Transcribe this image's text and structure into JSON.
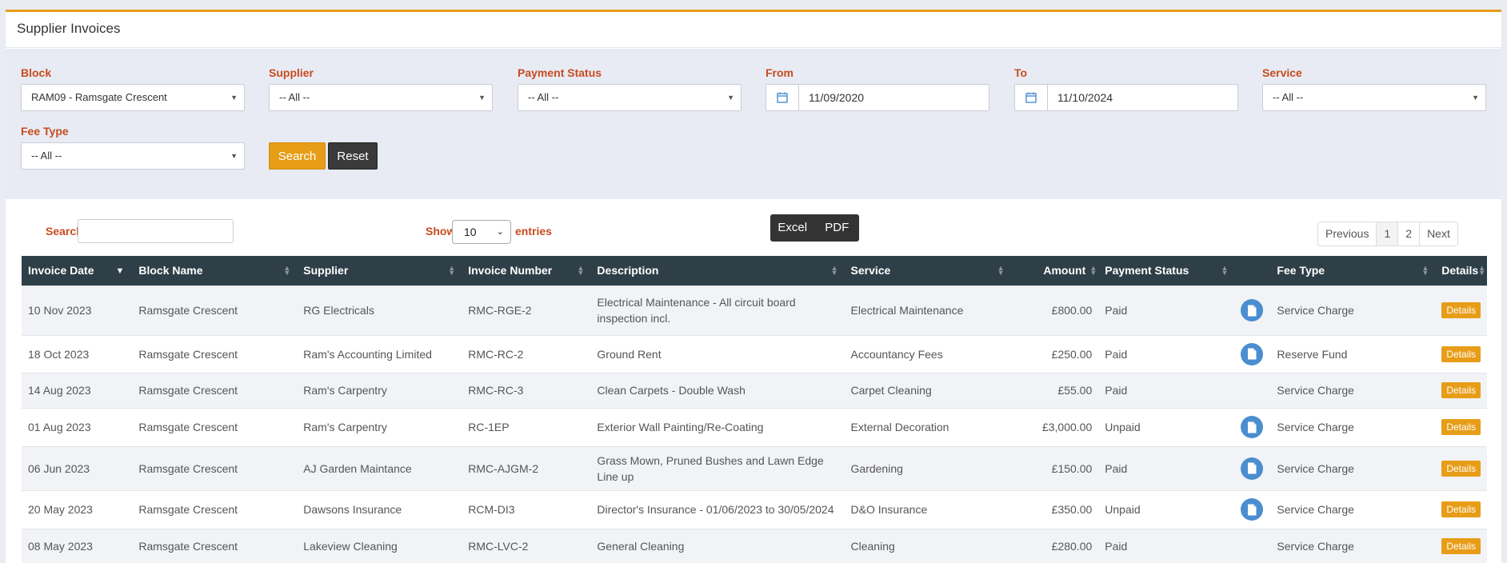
{
  "page": {
    "title": "Supplier Invoices"
  },
  "filters": {
    "block": {
      "label": "Block",
      "value": "RAM09 - Ramsgate Crescent"
    },
    "supplier": {
      "label": "Supplier",
      "value": "-- All --"
    },
    "payment_status": {
      "label": "Payment Status",
      "value": "-- All --"
    },
    "from": {
      "label": "From",
      "value": "11/09/2020"
    },
    "to": {
      "label": "To",
      "value": "11/10/2024"
    },
    "service": {
      "label": "Service",
      "value": "-- All --"
    },
    "fee_type": {
      "label": "Fee Type",
      "value": "-- All --"
    },
    "search_label": "Search",
    "reset_label": "Reset"
  },
  "toolbar": {
    "search_label": "Search:",
    "show_label": "Show",
    "entries_value": "10",
    "entries_label": "entries",
    "excel_label": "Excel",
    "pdf_label": "PDF",
    "pager": {
      "previous": "Previous",
      "pages": [
        "1",
        "2"
      ],
      "next": "Next"
    }
  },
  "table": {
    "headers": [
      "Invoice Date",
      "Block Name",
      "Supplier",
      "Invoice Number",
      "Description",
      "Service",
      "Amount",
      "Payment Status",
      "",
      "Fee Type",
      "Details"
    ],
    "details_label": "Details",
    "rows": [
      {
        "date": "10 Nov 2023",
        "block": "Ramsgate Crescent",
        "supplier": "RG Electricals",
        "invoice": "RMC-RGE-2",
        "description": "Electrical Maintenance - All circuit board inspection incl.",
        "service": "Electrical Maintenance",
        "amount": "£800.00",
        "status": "Paid",
        "has_doc": true,
        "fee_type": "Service Charge"
      },
      {
        "date": "18 Oct 2023",
        "block": "Ramsgate Crescent",
        "supplier": "Ram's Accounting Limited",
        "invoice": "RMC-RC-2",
        "description": "Ground Rent",
        "service": "Accountancy Fees",
        "amount": "£250.00",
        "status": "Paid",
        "has_doc": true,
        "fee_type": "Reserve Fund"
      },
      {
        "date": "14 Aug 2023",
        "block": "Ramsgate Crescent",
        "supplier": "Ram's Carpentry",
        "invoice": "RMC-RC-3",
        "description": "Clean Carpets - Double Wash",
        "service": "Carpet Cleaning",
        "amount": "£55.00",
        "status": "Paid",
        "has_doc": false,
        "fee_type": "Service Charge"
      },
      {
        "date": "01 Aug 2023",
        "block": "Ramsgate Crescent",
        "supplier": "Ram's Carpentry",
        "invoice": "RC-1EP",
        "description": "Exterior Wall Painting/Re-Coating",
        "service": "External Decoration",
        "amount": "£3,000.00",
        "status": "Unpaid",
        "has_doc": true,
        "fee_type": "Service Charge"
      },
      {
        "date": "06 Jun 2023",
        "block": "Ramsgate Crescent",
        "supplier": "AJ Garden Maintance",
        "invoice": "RMC-AJGM-2",
        "description": "Grass Mown, Pruned Bushes and Lawn Edge Line up",
        "service": "Gardening",
        "amount": "£150.00",
        "status": "Paid",
        "has_doc": true,
        "fee_type": "Service Charge"
      },
      {
        "date": "20 May 2023",
        "block": "Ramsgate Crescent",
        "supplier": "Dawsons Insurance",
        "invoice": "RCM-DI3",
        "description": "Director's Insurance - 01/06/2023 to 30/05/2024",
        "service": "D&O Insurance",
        "amount": "£350.00",
        "status": "Unpaid",
        "has_doc": true,
        "fee_type": "Service Charge"
      },
      {
        "date": "08 May 2023",
        "block": "Ramsgate Crescent",
        "supplier": "Lakeview Cleaning",
        "invoice": "RMC-LVC-2",
        "description": "General Cleaning",
        "service": "Cleaning",
        "amount": "£280.00",
        "status": "Paid",
        "has_doc": false,
        "fee_type": "Service Charge"
      }
    ]
  }
}
